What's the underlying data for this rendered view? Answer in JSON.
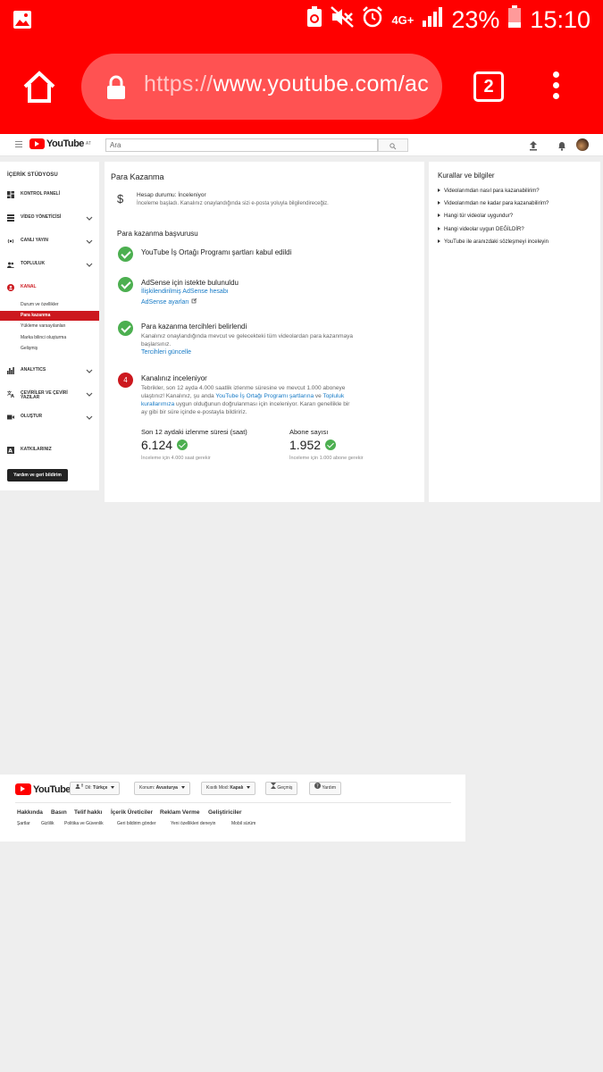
{
  "status_bar": {
    "battery_percent": "23%",
    "time": "15:10",
    "network": "4G+"
  },
  "browser": {
    "url_scheme": "https://",
    "url_host": "www.youtube.com/ac",
    "tab_count": "2"
  },
  "header": {
    "logo_text": "YouTube",
    "logo_region": "AT",
    "search_placeholder": "Ara"
  },
  "sidebar": {
    "title": "İÇERİK STÜDYOSU",
    "items": [
      {
        "label": "KONTROL PANELİ",
        "icon": "dashboard-icon"
      },
      {
        "label": "VİDEO YÖNETİCİSİ",
        "icon": "video-manager-icon"
      },
      {
        "label": "CANLI YAYIN",
        "icon": "live-icon"
      },
      {
        "label": "TOPLULUK",
        "icon": "community-icon"
      },
      {
        "label": "KANAL",
        "icon": "channel-icon"
      }
    ],
    "kanal_sub": [
      "Durum ve özellikler",
      "Para kazanma",
      "Yükleme varsayılanları",
      "Marka bilinci oluşturma",
      "Gelişmiş"
    ],
    "items2": [
      {
        "label": "ANALYTICS",
        "icon": "analytics-icon"
      },
      {
        "label_line1": "ÇEVİRİLER VE ÇEVİRİ",
        "label_line2": "YAZILAR",
        "icon": "translate-icon"
      },
      {
        "label": "OLUŞTUR",
        "icon": "create-icon"
      }
    ],
    "contributions": "KATKILARINIZ",
    "help_button": "Yardım ve geri bildirim"
  },
  "main": {
    "title": "Para Kazanma",
    "account_status": "Hesap durumu: İnceleniyor",
    "account_status_desc": "İnceleme başladı. Kanalınız onaylandığında sizi e-posta yoluyla bilgilendireceğiz.",
    "application_title": "Para kazanma başvurusu",
    "step1": {
      "title": "YouTube İş Ortağı Programı şartları kabul edildi"
    },
    "step2": {
      "title": "AdSense için istekte bulunuldu",
      "link1": "İlişkilendirilmiş AdSense hesabı",
      "link2": "AdSense ayarları"
    },
    "step3": {
      "title": "Para kazanma tercihleri belirlendi",
      "desc": "Kanalınız onaylandığında mevcut ve gelecekteki tüm videolardan para kazanmaya başlarsınız.",
      "link": "Tercihleri güncelle"
    },
    "step4": {
      "number": "4",
      "title": "Kanalınız inceleniyor",
      "desc_a": "Tebrikler, son 12 ayda 4.000 saatlik izlenme süresine ve mevcut 1.000 aboneye ulaştınız! Kanalınız, şu anda ",
      "desc_link1": "YouTube İş Ortağı Programı şartlarına",
      "desc_b": " ve ",
      "desc_link2": "Topluluk kurallarımıza",
      "desc_c": " uygun olduğunun doğrulanması için inceleniyor. Kararı genellikle bir ay gibi bir süre içinde e-postayla bildiririz."
    },
    "stats": [
      {
        "title": "Son 12 aydaki izlenme süresi (saat)",
        "value": "6.124",
        "note": "İnceleme için 4.000 saat gerekir"
      },
      {
        "title": "Abone sayısı",
        "value": "1.952",
        "note": "İnceleme için 1.000 abone gerekir"
      }
    ]
  },
  "rules": {
    "title": "Kurallar ve bilgiler",
    "links": [
      "Videolarımdan nasıl para kazanabilirim?",
      "Videolarımdan ne kadar para kazanabilirim?",
      "Hangi tür videolar uygundur?",
      "Hangi videolar uygun DEĞİLDİR?",
      "YouTube ile aranızdaki sözleşmeyi inceleyin"
    ]
  },
  "footer": {
    "language_label": "Dil:",
    "language_value": "Türkçe",
    "location_label": "Konum:",
    "location_value": "Avusturya",
    "restricted_label": "Kısıtlı Mod:",
    "restricted_value": "Kapalı",
    "history": "Geçmiş",
    "help": "Yardım",
    "links": [
      "Hakkında",
      "Basın",
      "Telif hakkı",
      "İçerik Üreticiler",
      "Reklam Verme",
      "Geliştiriciler"
    ],
    "links2": [
      "Şartlar",
      "Gizlilik",
      "Politika ve Güvenlik",
      "Geri bildirim gönder",
      "Yeni özellikleri deneyin",
      "Mobil sürüm"
    ]
  },
  "colors": {
    "browser_red": "#ff0000",
    "yt_red": "#cc181e",
    "link_blue": "#167ac6",
    "success_green": "#4caf50"
  }
}
